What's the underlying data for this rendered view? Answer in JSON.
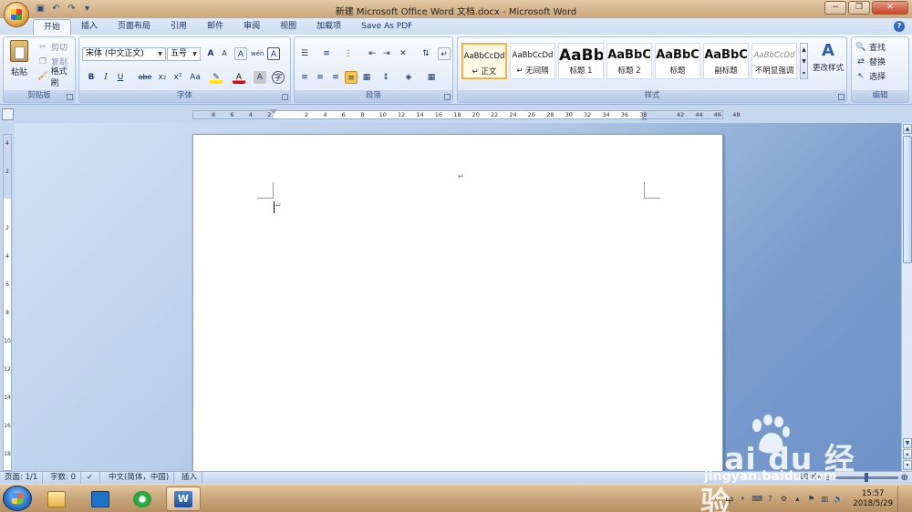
{
  "window": {
    "title": "新建 Microsoft Office Word 文档.docx - Microsoft Word",
    "controls": [
      "−",
      "❐",
      "✕"
    ]
  },
  "quick_access": [
    "save-icon",
    "undo-icon",
    "redo-icon",
    "customize-icon"
  ],
  "tabs": [
    {
      "label": "开始",
      "active": true
    },
    {
      "label": "插入"
    },
    {
      "label": "页面布局"
    },
    {
      "label": "引用"
    },
    {
      "label": "邮件"
    },
    {
      "label": "审阅"
    },
    {
      "label": "视图"
    },
    {
      "label": "加载项"
    },
    {
      "label": "Save As PDF"
    }
  ],
  "ribbon": {
    "clipboard": {
      "group_label": "剪贴板",
      "paste": "粘贴",
      "cut": "剪切",
      "copy": "复制",
      "format_painter": "格式刷"
    },
    "font": {
      "group_label": "字体",
      "font_name": "宋体 (中文正文)",
      "font_size": "五号",
      "bold": "B",
      "italic": "I",
      "underline": "U",
      "strike": "abe",
      "subscript": "x₂",
      "superscript": "x²",
      "change_case": "Aa",
      "grow": "A",
      "shrink": "A",
      "clear": "A",
      "phonetic": "wén",
      "border_char": "A",
      "font_color": "A",
      "char_shade": "A",
      "encircle": "字"
    },
    "paragraph": {
      "group_label": "段落"
    },
    "styles": {
      "group_label": "样式",
      "items": [
        {
          "sample": "AaBbCcDd",
          "name": "↵ 正文",
          "selected": true
        },
        {
          "sample": "AaBbCcDd",
          "name": "↵ 无间隔"
        },
        {
          "sample": "AaBb",
          "name": "标题 1"
        },
        {
          "sample": "AaBbC",
          "name": "标题 2"
        },
        {
          "sample": "AaBbC",
          "name": "标题"
        },
        {
          "sample": "AaBbC",
          "name": "副标题"
        },
        {
          "sample": "AaBbCcDd",
          "name": "不明显强调"
        }
      ],
      "change_styles": "更改样式"
    },
    "editing": {
      "group_label": "编辑",
      "find": "查找",
      "replace": "替换",
      "select": "选择"
    }
  },
  "ruler": {
    "h_ticks": [
      "8",
      "6",
      "4",
      "2",
      "",
      "2",
      "4",
      "6",
      "8",
      "10",
      "12",
      "14",
      "16",
      "18",
      "20",
      "22",
      "24",
      "26",
      "28",
      "30",
      "32",
      "34",
      "36",
      "38",
      "",
      "42",
      "44",
      "46",
      "48"
    ],
    "v_ticks": [
      "4",
      "2",
      "",
      "2",
      "4",
      "6",
      "8",
      "10",
      "12",
      "14",
      "16",
      "18"
    ]
  },
  "status": {
    "page": "页面: 1/1",
    "words": "字数: 0",
    "language": "中文(简体，中国)",
    "mode": "插入",
    "zoom": "100%"
  },
  "taskbar": {
    "items": [
      "explorer-icon",
      "app-icon",
      "browser-icon",
      "word-icon"
    ],
    "ime": "中",
    "time": "15:57",
    "date": "2018/5/29"
  },
  "watermark": {
    "text": "Bai du 经验",
    "url": "jingyan.baidu.com"
  }
}
